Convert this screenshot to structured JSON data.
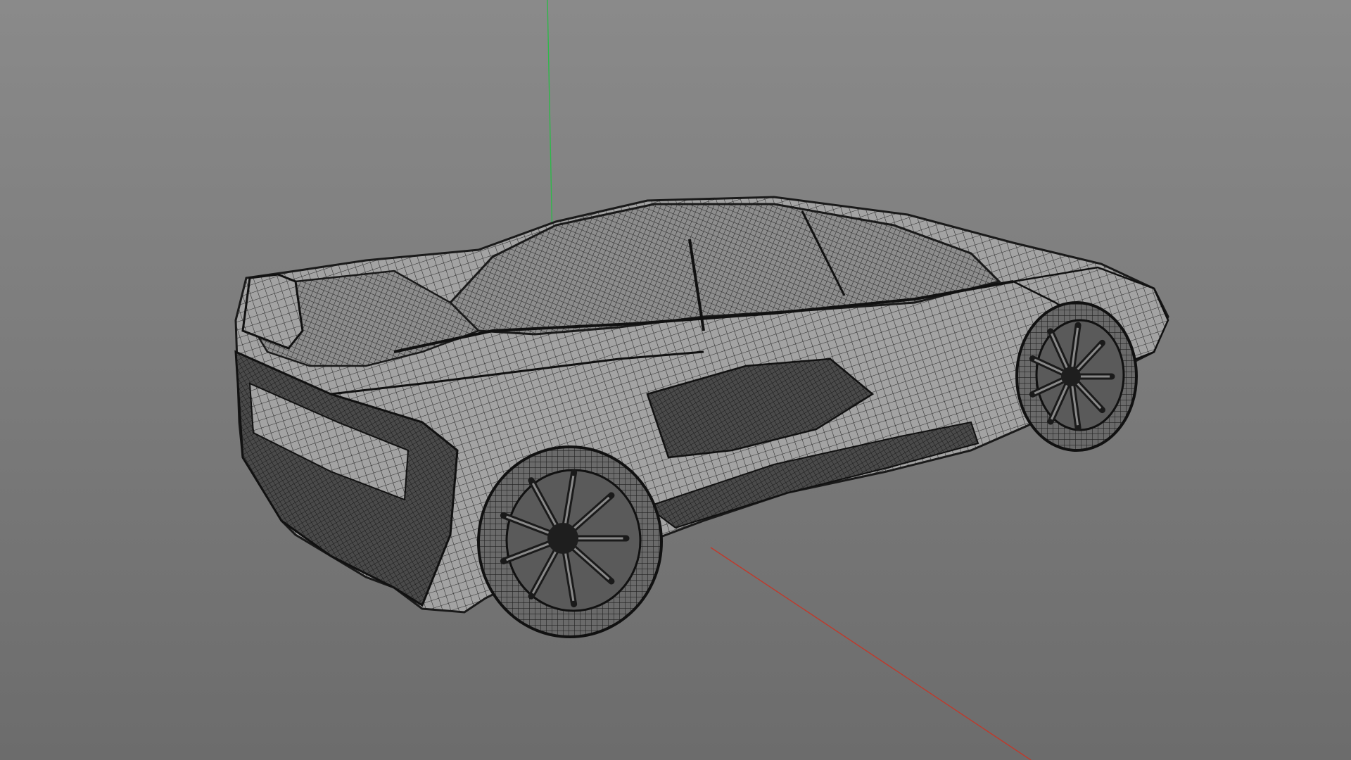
{
  "viewport": {
    "background_top": "#8a8a8a",
    "background_bottom": "#6c6c6c",
    "render_mode": "wireframe"
  },
  "axes": {
    "y_axis_color": "#2fb84a",
    "x_axis_color": "#c0392b"
  },
  "model": {
    "object": "sports-car",
    "wire_color": "#1e1e1e",
    "surface_color": "#9b9b9b"
  }
}
